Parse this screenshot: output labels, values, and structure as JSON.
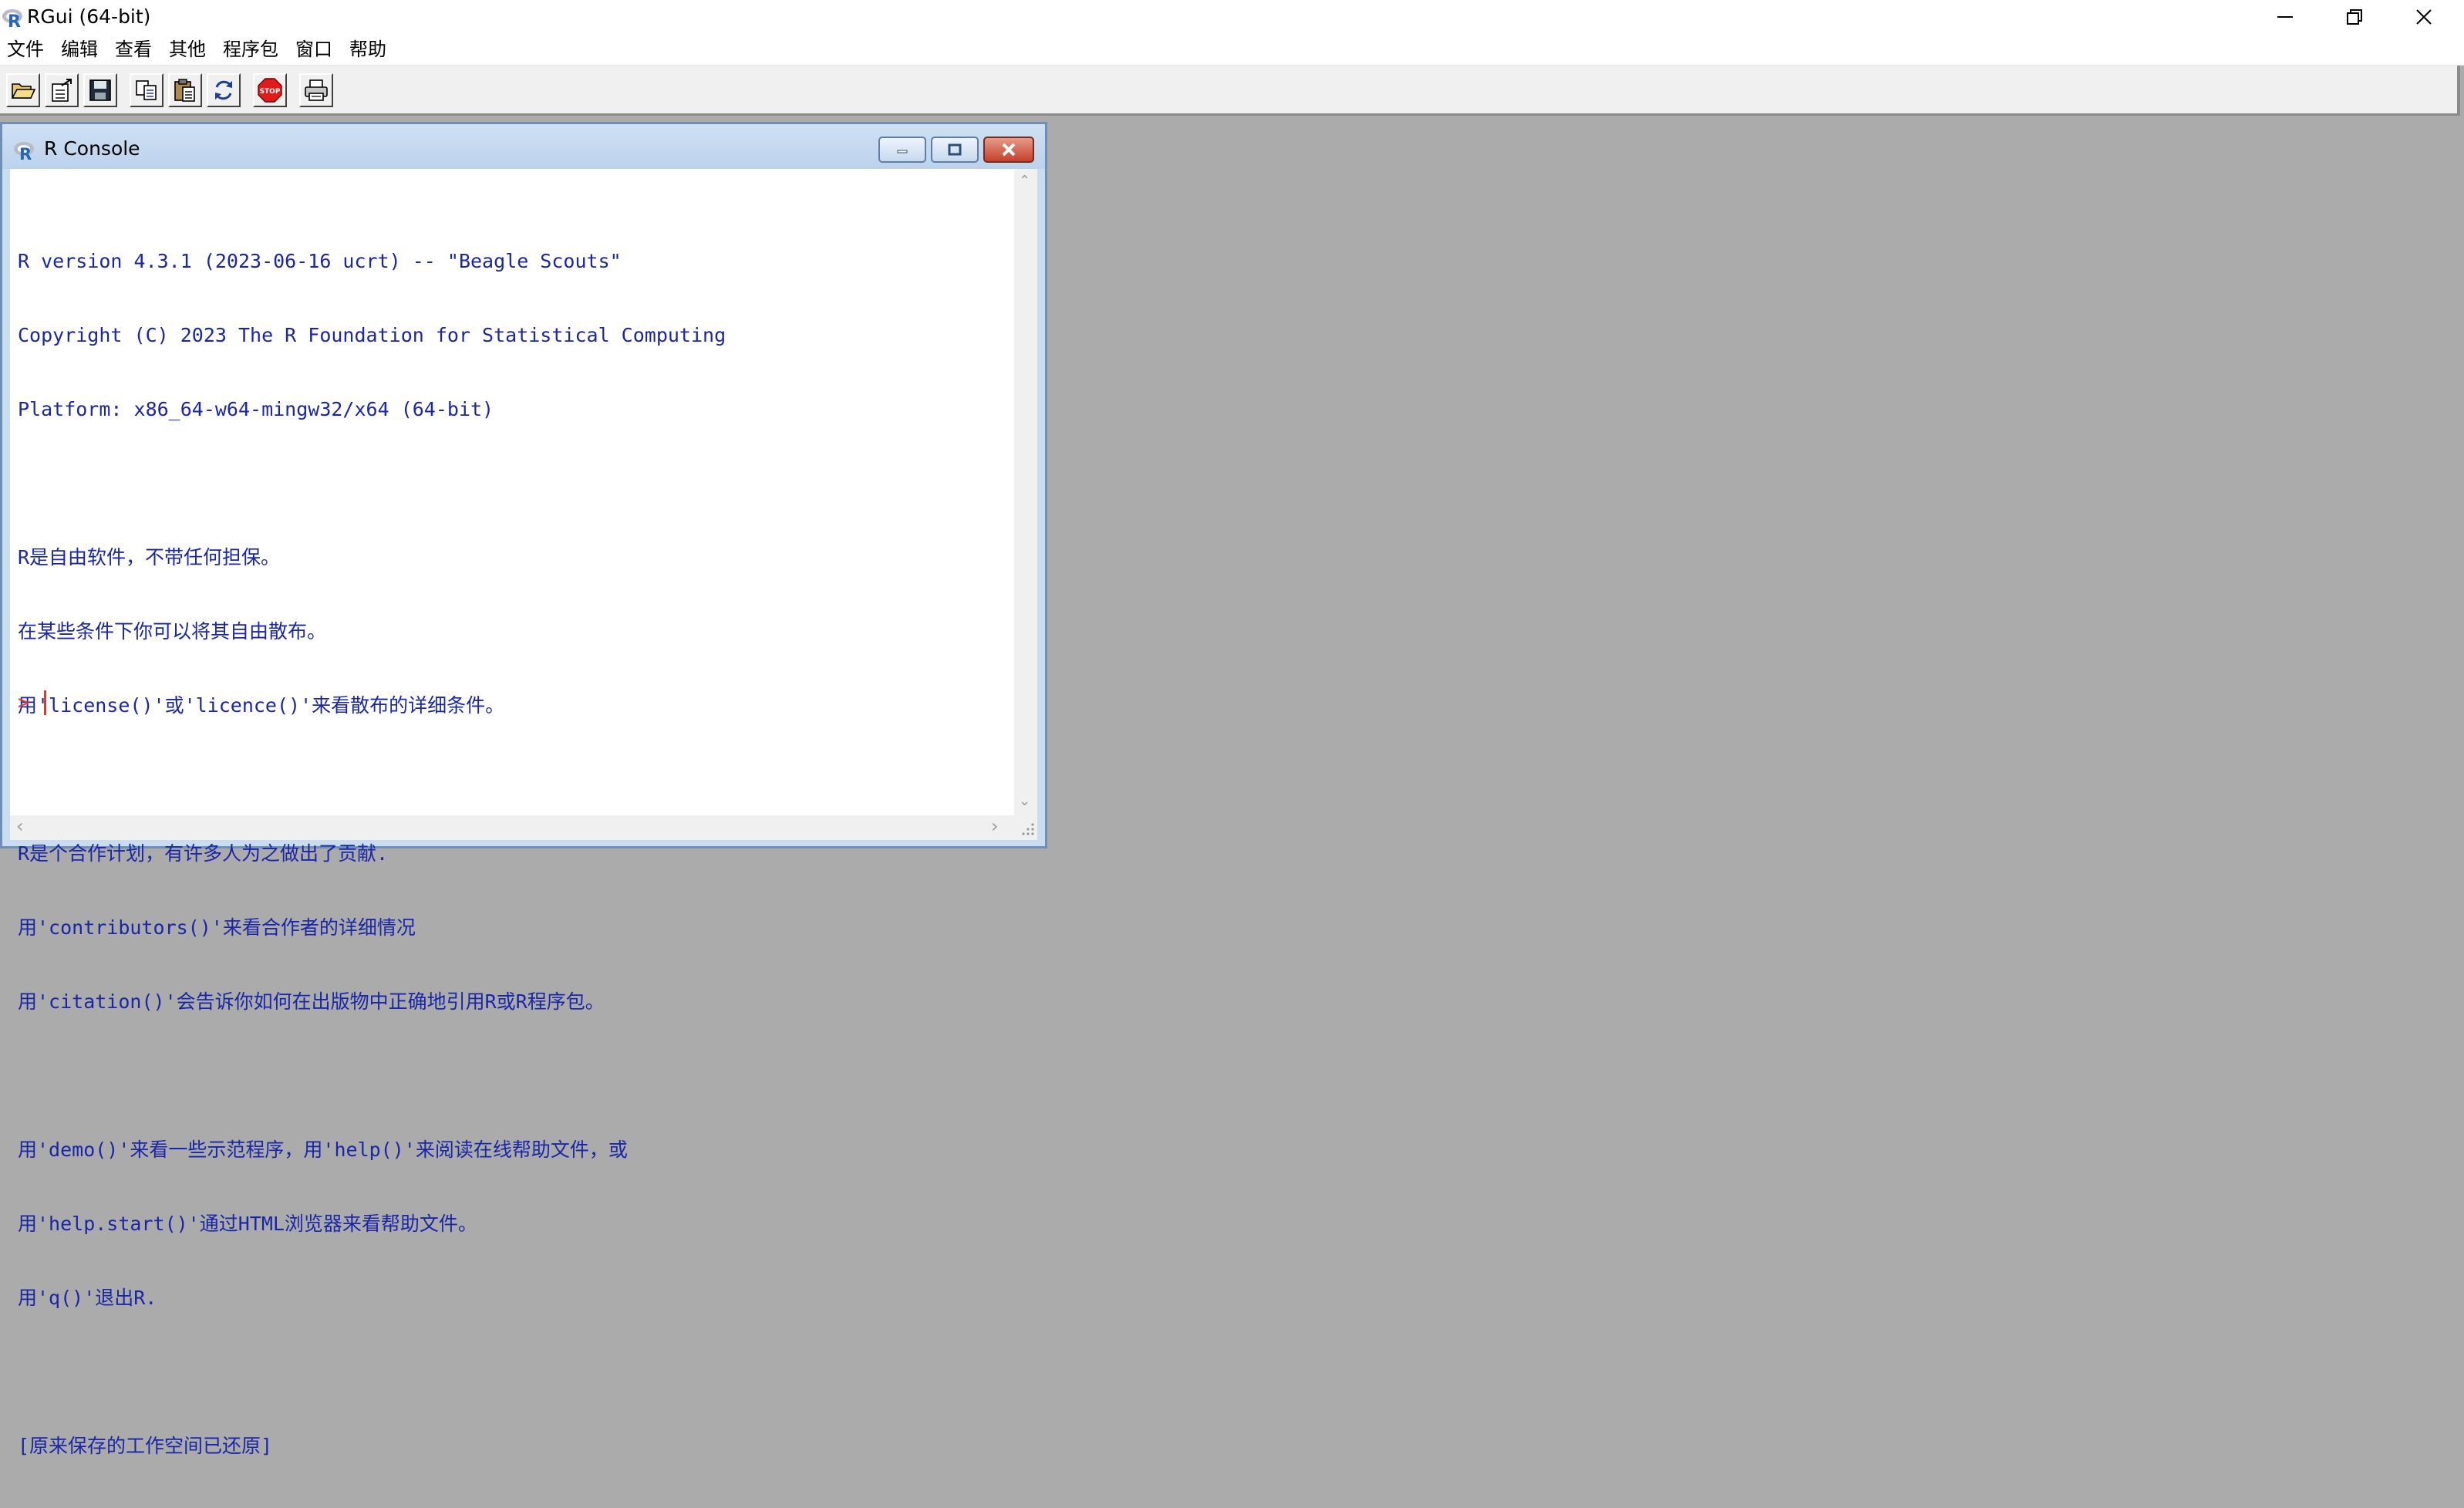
{
  "app": {
    "title": "RGui (64-bit)"
  },
  "menu": {
    "items": [
      "文件",
      "编辑",
      "查看",
      "其他",
      "程序包",
      "窗口",
      "帮助"
    ]
  },
  "toolbar": {
    "buttons": [
      {
        "name": "open-script-button",
        "icon": "open-folder-icon"
      },
      {
        "name": "load-workspace-button",
        "icon": "load-workspace-icon"
      },
      {
        "name": "save-workspace-button",
        "icon": "save-icon"
      },
      {
        "name": "copy-button",
        "icon": "copy-icon"
      },
      {
        "name": "paste-button",
        "icon": "paste-icon"
      },
      {
        "name": "copy-paste-button",
        "icon": "refresh-icon"
      },
      {
        "name": "stop-button",
        "icon": "stop-icon",
        "label": "STOP"
      },
      {
        "name": "print-button",
        "icon": "printer-icon"
      }
    ]
  },
  "console": {
    "title": "R Console",
    "lines": [
      "R version 4.3.1 (2023-06-16 ucrt) -- \"Beagle Scouts\"",
      "Copyright (C) 2023 The R Foundation for Statistical Computing",
      "Platform: x86_64-w64-mingw32/x64 (64-bit)",
      "",
      "R是自由软件，不带任何担保。",
      "在某些条件下你可以将其自由散布。",
      "用'license()'或'licence()'来看散布的详细条件。",
      "",
      "R是个合作计划，有许多人为之做出了贡献.",
      "用'contributors()'来看合作者的详细情况",
      "用'citation()'会告诉你如何在出版物中正确地引用R或R程序包。",
      "",
      "用'demo()'来看一些示范程序，用'help()'来阅读在线帮助文件，或",
      "用'help.start()'通过HTML浏览器来看帮助文件。",
      "用'q()'退出R.",
      "",
      "[原来保存的工作空间已还原]",
      ""
    ],
    "prompt": ">"
  },
  "colors": {
    "console_text": "#1a26a8",
    "prompt": "#e23a2a",
    "mdi_background": "#ababab"
  }
}
